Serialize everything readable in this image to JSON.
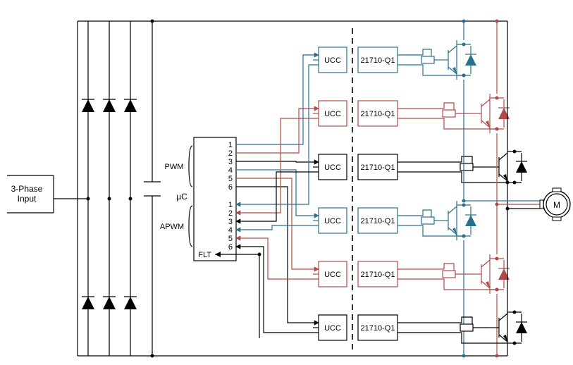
{
  "input_label_line1": "3-Phase",
  "input_label_line2": "Input",
  "mcu_label": "µC",
  "pwm_label": "PWM",
  "apwm_label": "APWM",
  "flt_label": "FLT",
  "pwm_pins": [
    "1",
    "2",
    "3",
    "4",
    "5",
    "6"
  ],
  "apwm_pins": [
    "1",
    "2",
    "3",
    "4",
    "5",
    "6"
  ],
  "driver_label_left": "UCC",
  "driver_label_right": "21710-Q1",
  "motor_label": "M",
  "colors": {
    "blue": "#2a6f8e",
    "red": "#b04a4a",
    "black": "#000000"
  }
}
